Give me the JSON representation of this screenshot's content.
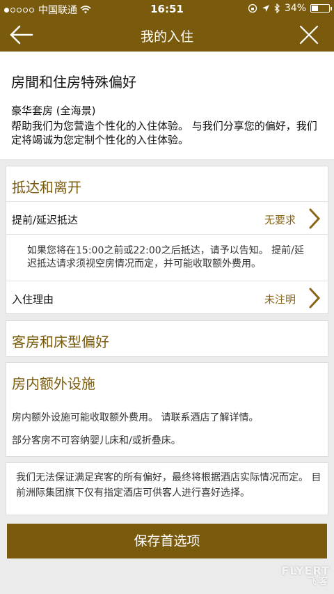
{
  "status_bar": {
    "carrier": "中国联通",
    "time": "16:51",
    "battery": "34%",
    "battery_level": 0.34
  },
  "nav": {
    "title": "我的入住"
  },
  "intro": {
    "heading": "房間和住房特殊偏好",
    "room_type": "豪华套房 (全海景)",
    "description": "帮助我们为您营造个性化的入住体验。 与我们分享您的偏好，我们定将竭诚为您定制个性化的入住体验。"
  },
  "arrival": {
    "title": "抵达和离开",
    "early_late": {
      "label": "提前/延迟抵达",
      "value": "无要求"
    },
    "note": "如果您将在15:00之前或22:00之后抵达，请予以告知。 提前/延迟抵达请求须视空房情况而定，并可能收取额外费用。",
    "reason": {
      "label": "入住理由",
      "value": "未注明"
    }
  },
  "room_bed": {
    "title": "客房和床型偏好"
  },
  "amenities": {
    "title": "房内额外设施",
    "note1": "房内额外设施可能收取额外费用。 请联系酒店了解详情。",
    "note2": "部分客房不可容纳婴儿床和/或折叠床。"
  },
  "disclaimer": "我们无法保证满足宾客的所有偏好，最终将根据酒店实际情况而定。 目前洲际集团旗下仅有指定酒店可供客人进行喜好选择。",
  "save_label": "保存首选项",
  "watermark": {
    "brand": "FLYERT",
    "sub": "飞客"
  },
  "colors": {
    "brand": "#7a5a0c",
    "accent_text": "#8a6516",
    "background": "#ebebeb"
  },
  "icons": [
    "signal-dots-icon",
    "wifi-icon",
    "lock-rotation-icon",
    "location-arrow-icon",
    "bluetooth-icon",
    "battery-icon",
    "back-arrow-icon",
    "close-icon",
    "chevron-right-icon"
  ]
}
